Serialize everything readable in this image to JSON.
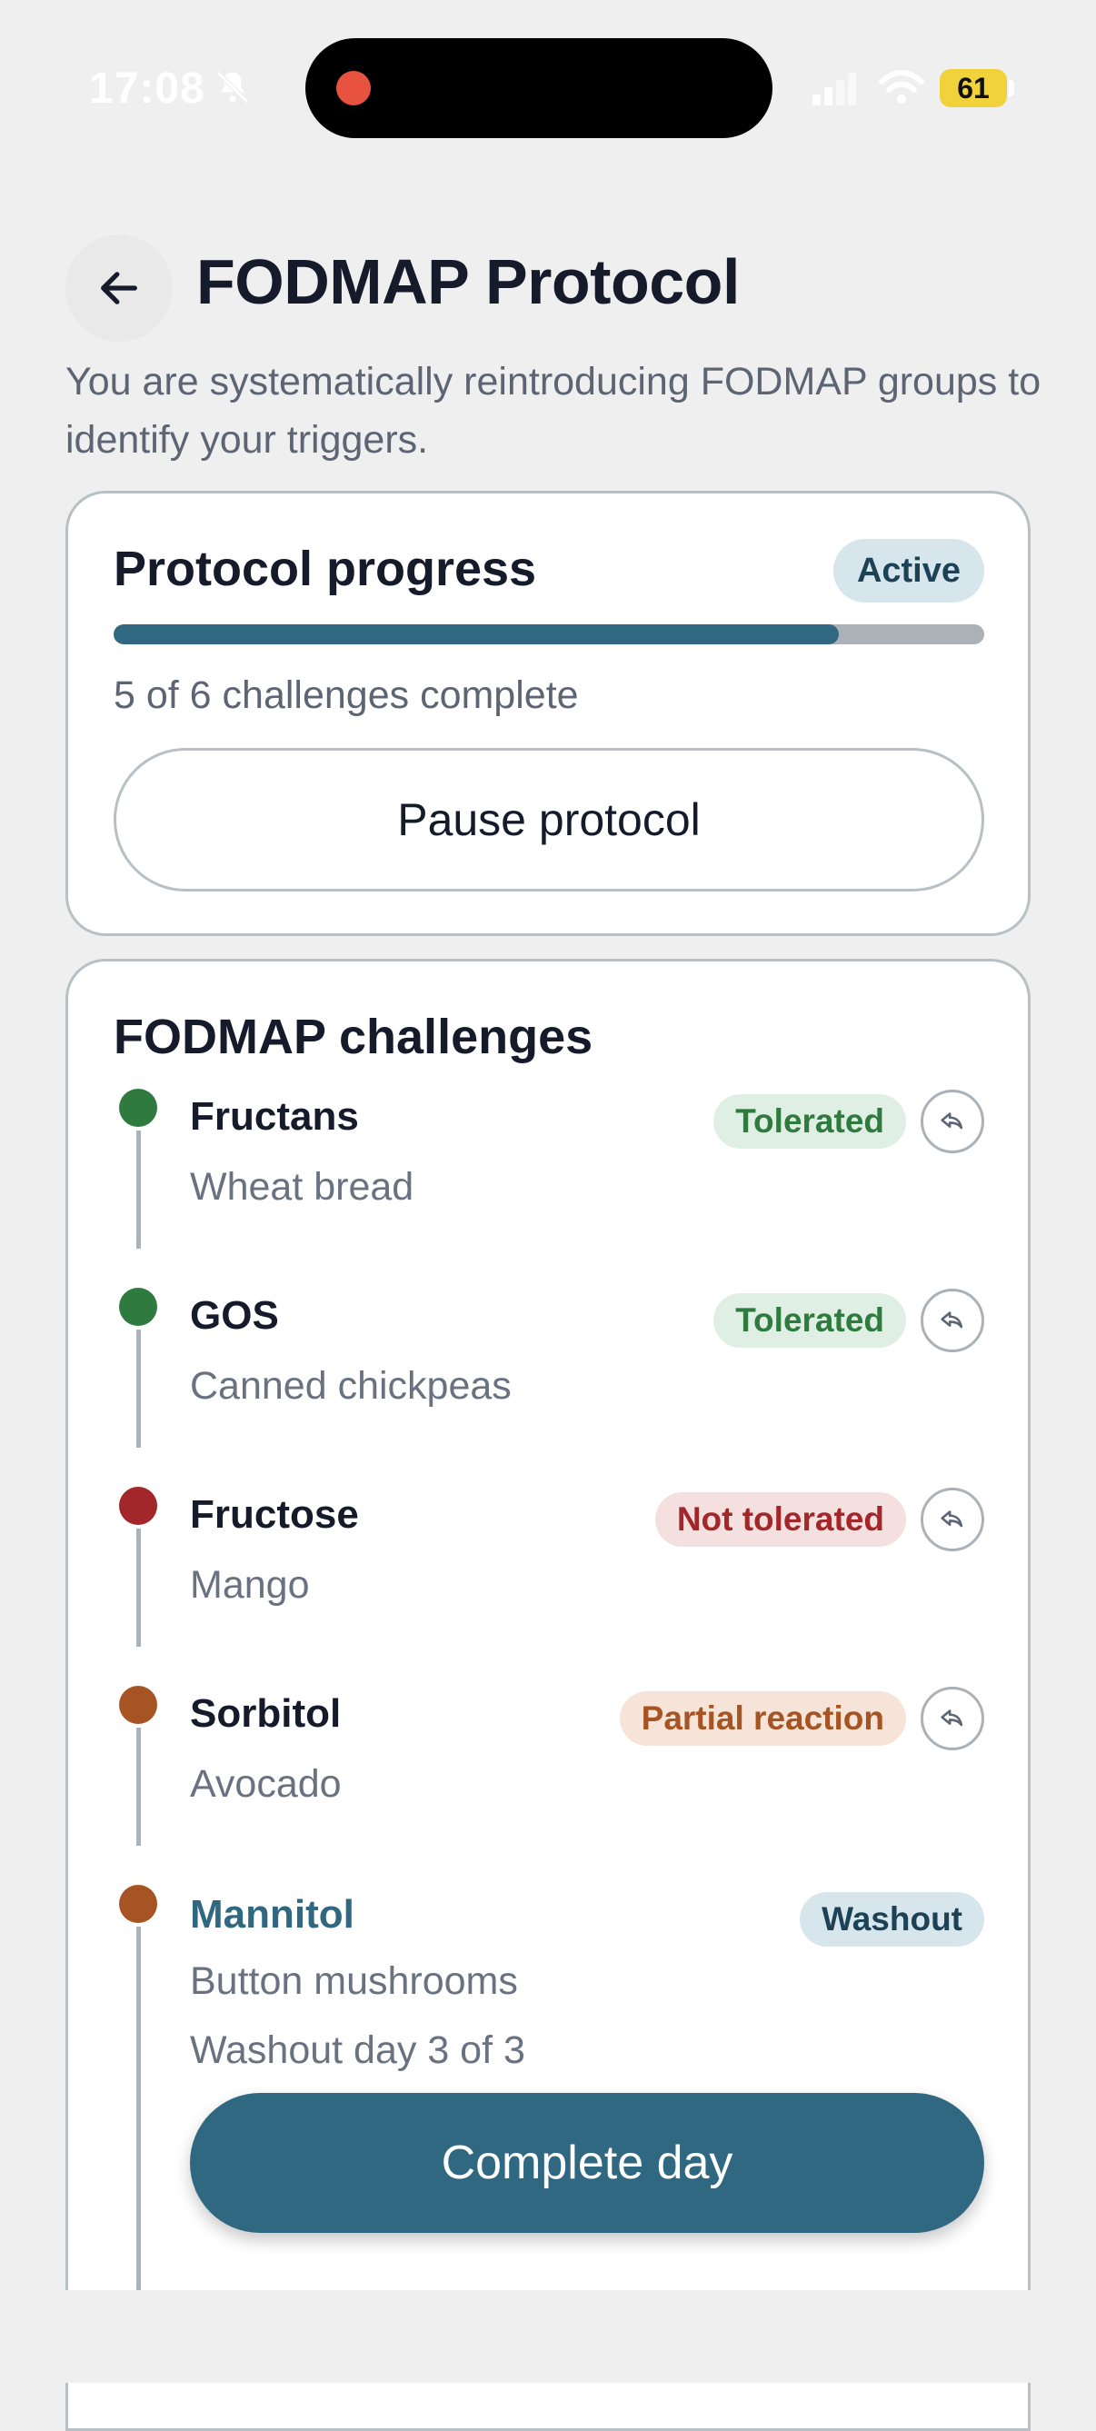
{
  "status_bar": {
    "time": "17:08",
    "battery": "61",
    "icons": [
      "bell-slash-icon",
      "signal-icon",
      "wifi-icon",
      "battery-icon"
    ]
  },
  "header": {
    "title": "FODMAP Protocol",
    "subtitle": "You are systematically reintroducing FODMAP groups to identify your triggers.",
    "back_icon": "arrow-left-icon"
  },
  "progress_card": {
    "title": "Protocol progress",
    "status": "Active",
    "completed": 5,
    "total": 6,
    "progress_fraction": 0.833,
    "summary": "5 of 6 challenges complete",
    "pause_label": "Pause protocol"
  },
  "challenges": {
    "title": "FODMAP challenges",
    "items": [
      {
        "name": "Fructans",
        "food": "Wheat bread",
        "status": "Tolerated",
        "tone": "green",
        "dot_color": "#2f7a3e"
      },
      {
        "name": "GOS",
        "food": "Canned chickpeas",
        "status": "Tolerated",
        "tone": "green",
        "dot_color": "#2f7a3e"
      },
      {
        "name": "Fructose",
        "food": "Mango",
        "status": "Not tolerated",
        "tone": "red",
        "dot_color": "#a3262a"
      },
      {
        "name": "Sorbitol",
        "food": "Avocado",
        "status": "Partial reaction",
        "tone": "orange",
        "dot_color": "#a65424"
      },
      {
        "name": "Mannitol",
        "food": "Button mushrooms",
        "status": "Washout",
        "tone": "blue",
        "dot_color": "#a65424",
        "detail": "Washout day 3 of 3"
      }
    ],
    "complete_label": "Complete day"
  },
  "colors": {
    "accent": "#2f6880",
    "background": "#efefef"
  }
}
